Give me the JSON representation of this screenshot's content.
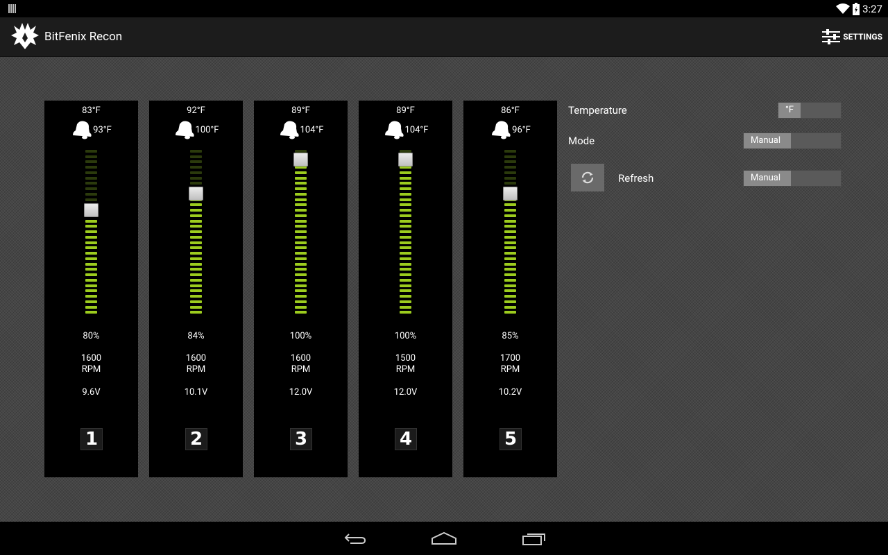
{
  "status_bar": {
    "time": "3:27"
  },
  "app": {
    "title": "BitFenix Recon",
    "settings_label": "SETTINGS"
  },
  "channels": [
    {
      "temp": "83°F",
      "alarm": "93°F",
      "percent": "80%",
      "percent_value": 80,
      "rpm": "1600",
      "rpm_unit": "RPM",
      "voltage": "9.6V",
      "number": "1"
    },
    {
      "temp": "92°F",
      "alarm": "100°F",
      "percent": "84%",
      "percent_value": 84,
      "rpm": "1600",
      "rpm_unit": "RPM",
      "voltage": "10.1V",
      "number": "2"
    },
    {
      "temp": "89°F",
      "alarm": "104°F",
      "percent": "100%",
      "percent_value": 100,
      "rpm": "1600",
      "rpm_unit": "RPM",
      "voltage": "12.0V",
      "number": "3"
    },
    {
      "temp": "89°F",
      "alarm": "104°F",
      "percent": "100%",
      "percent_value": 100,
      "rpm": "1500",
      "rpm_unit": "RPM",
      "voltage": "12.0V",
      "number": "4"
    },
    {
      "temp": "86°F",
      "alarm": "96°F",
      "percent": "85%",
      "percent_value": 85,
      "rpm": "1700",
      "rpm_unit": "RPM",
      "voltage": "10.2V",
      "number": "5"
    }
  ],
  "settings_panel": {
    "temperature_label": "Temperature",
    "temperature_unit": "°F",
    "mode_label": "Mode",
    "mode_value": "Manual",
    "refresh_label": "Refresh",
    "refresh_value": "Manual"
  },
  "colors": {
    "meter_on": "#9ccc1e",
    "meter_off": "#2b3a0c",
    "background": "#454545"
  }
}
